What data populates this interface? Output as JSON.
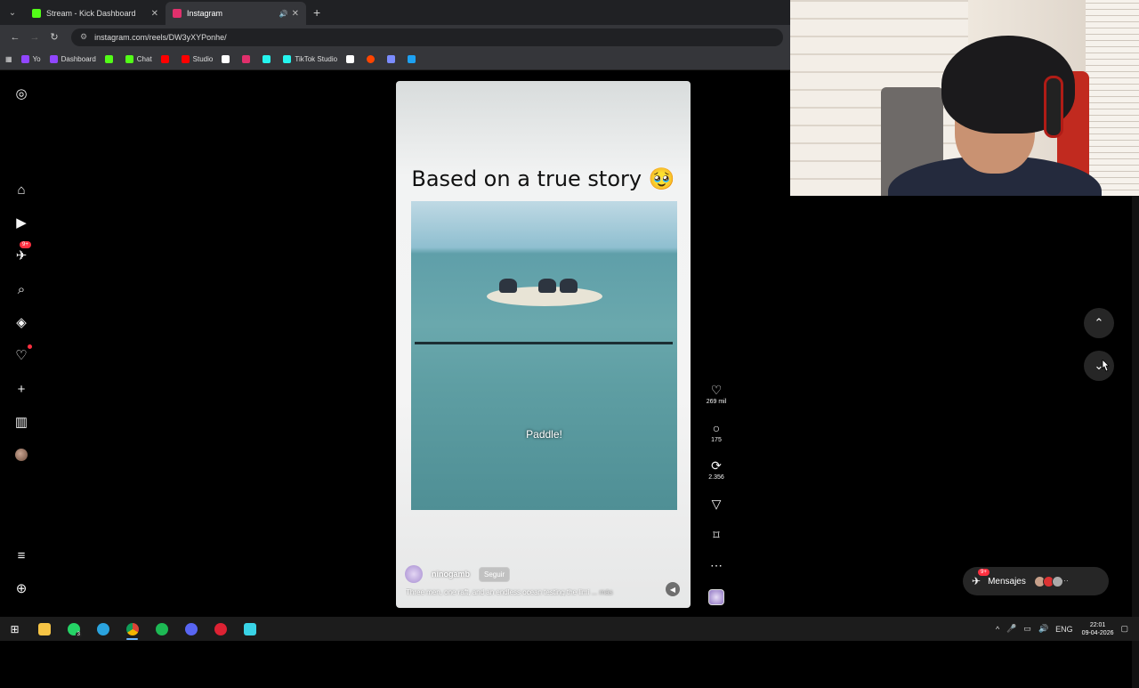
{
  "browser": {
    "tabs": [
      {
        "title": "Stream - Kick Dashboard",
        "favicon_color": "#53fc18",
        "active": false
      },
      {
        "title": "Instagram",
        "favicon_color": "#e1306c",
        "active": true
      }
    ],
    "url": "instagram.com/reels/DW3yXYPonhe/",
    "bookmarks": [
      {
        "label": "Yo",
        "color": "#9146ff"
      },
      {
        "label": "Dashboard",
        "color": "#9146ff"
      },
      {
        "label": "",
        "color": "#53fc18"
      },
      {
        "label": "Chat",
        "color": "#53fc18"
      },
      {
        "label": "",
        "color": "#ff0000"
      },
      {
        "label": "Studio",
        "color": "#ff0000"
      },
      {
        "label": "",
        "color": "#ffffff"
      },
      {
        "label": "",
        "color": "#e1306c"
      },
      {
        "label": "",
        "color": "#25f4ee"
      },
      {
        "label": "TikTok Studio",
        "color": "#25f4ee"
      },
      {
        "label": "",
        "color": "#ffffff"
      },
      {
        "label": "",
        "color": "#ff4500"
      },
      {
        "label": "",
        "color": "#7b8cff"
      },
      {
        "label": "",
        "color": "#1da1f2"
      }
    ]
  },
  "sidebar": {
    "messages_badge": "9+"
  },
  "reel": {
    "title": "Based on a true story 🥹",
    "video_caption": "Paddle!",
    "author": "ninogamb",
    "follow_label": "Seguir",
    "description": "Three men, one raft, and an endless ocean testing the limi",
    "more_label": "... más",
    "likes": "269 mil",
    "comments": "175",
    "reposts": "2.356"
  },
  "messages": {
    "label": "Mensajes",
    "badge": "9+"
  },
  "taskbar": {
    "whatsapp_badge": "3",
    "language": "ENG",
    "time": "22:01",
    "date": "09-04-2026"
  }
}
